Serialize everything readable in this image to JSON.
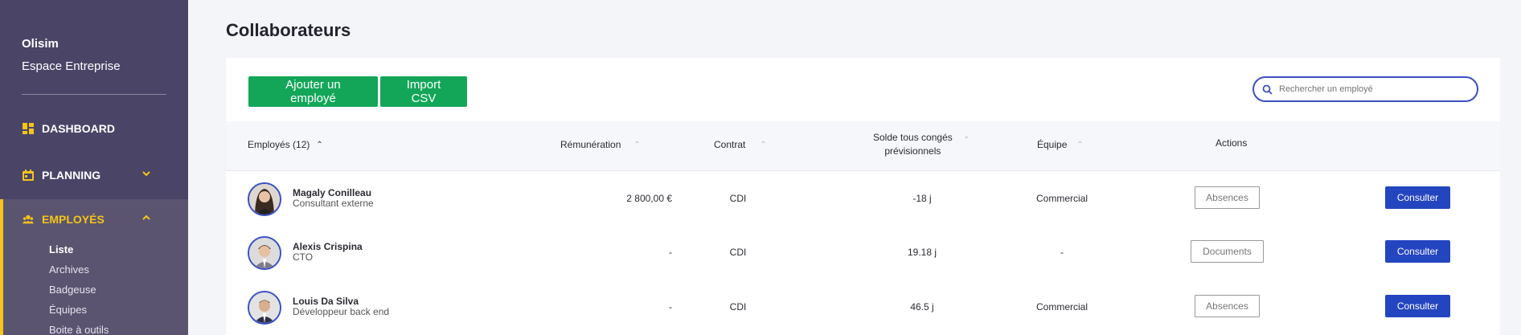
{
  "sidebar": {
    "company": "Olisim",
    "space": "Espace Entreprise",
    "nav": [
      {
        "label": "DASHBOARD",
        "icon": "dashboard-icon"
      },
      {
        "label": "PLANNING",
        "icon": "calendar-icon"
      },
      {
        "label": "EMPLOYÉS",
        "icon": "users-icon"
      }
    ],
    "submenu": [
      "Liste",
      "Archives",
      "Badgeuse",
      "Équipes",
      "Boite à outils"
    ]
  },
  "page": {
    "title": "Collaborateurs"
  },
  "toolbar": {
    "add_label": "Ajouter un employé",
    "csv_label": "Import CSV",
    "search_placeholder": "Rechercher un employé"
  },
  "table": {
    "headers": {
      "employees": "Employés (12)",
      "pay": "Rémunération",
      "contract": "Contrat",
      "leave_line1": "Solde tous congés",
      "leave_line2": "prévisionnels",
      "team": "Équipe",
      "actions": "Actions"
    },
    "rows": [
      {
        "name": "Magaly Conilleau",
        "role": "Consultant externe",
        "pay": "2 800,00 €",
        "contract": "CDI",
        "leave": "-18 j",
        "team": "Commercial",
        "action": "Absences",
        "consult": "Consulter"
      },
      {
        "name": "Alexis Crispina",
        "role": "CTO",
        "pay": "-",
        "contract": "CDI",
        "leave": "19.18 j",
        "team": "-",
        "action": "Documents",
        "consult": "Consulter"
      },
      {
        "name": "Louis Da Silva",
        "role": "Développeur back end",
        "pay": "-",
        "contract": "CDI",
        "leave": "46.5 j",
        "team": "Commercial",
        "action": "Absences",
        "consult": "Consulter"
      }
    ]
  },
  "colors": {
    "sidebar": "#4a4567",
    "accent_yellow": "#f5c518",
    "green": "#13a659",
    "blue": "#2445c0"
  }
}
